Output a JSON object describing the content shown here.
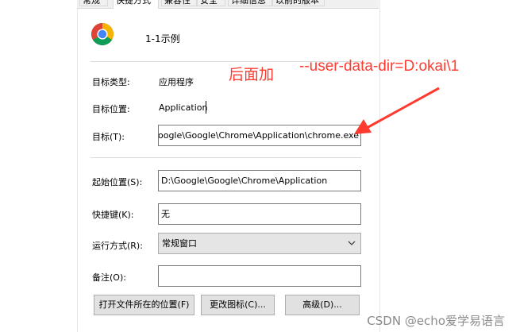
{
  "tabs": [
    {
      "label": "常规"
    },
    {
      "label": "快捷方式"
    },
    {
      "label": "兼容性"
    },
    {
      "label": "安全"
    },
    {
      "label": "详细信息"
    },
    {
      "label": "以前的版本"
    }
  ],
  "shortcut": {
    "name": "1-1示例",
    "icon": "chrome-icon"
  },
  "properties": {
    "target_type": {
      "label": "目标类型:",
      "value": "应用程序"
    },
    "target_location": {
      "label": "目标位置:",
      "value": "Application"
    },
    "target": {
      "label": "目标(T):",
      "value": "oogle\\Google\\Chrome\\Application\\chrome.exe"
    },
    "start_in": {
      "label": "起始位置(S):",
      "value": "D:\\Google\\Google\\Chrome\\Application"
    },
    "shortcut_key": {
      "label": "快捷键(K):",
      "value": "无"
    },
    "run": {
      "label": "运行方式(R):",
      "value": "常规窗口"
    },
    "comment": {
      "label": "备注(O):",
      "value": ""
    }
  },
  "buttons": {
    "open_location": "打开文件所在的位置(F)",
    "change_icon": "更改图标(C)...",
    "advanced": "高级(D)..."
  },
  "annotations": {
    "append_note": "后面加",
    "argument": "--user-data-dir=D:okai\\1",
    "color": "#ff3b30"
  },
  "watermark": "CSDN @echo爱学易语言"
}
